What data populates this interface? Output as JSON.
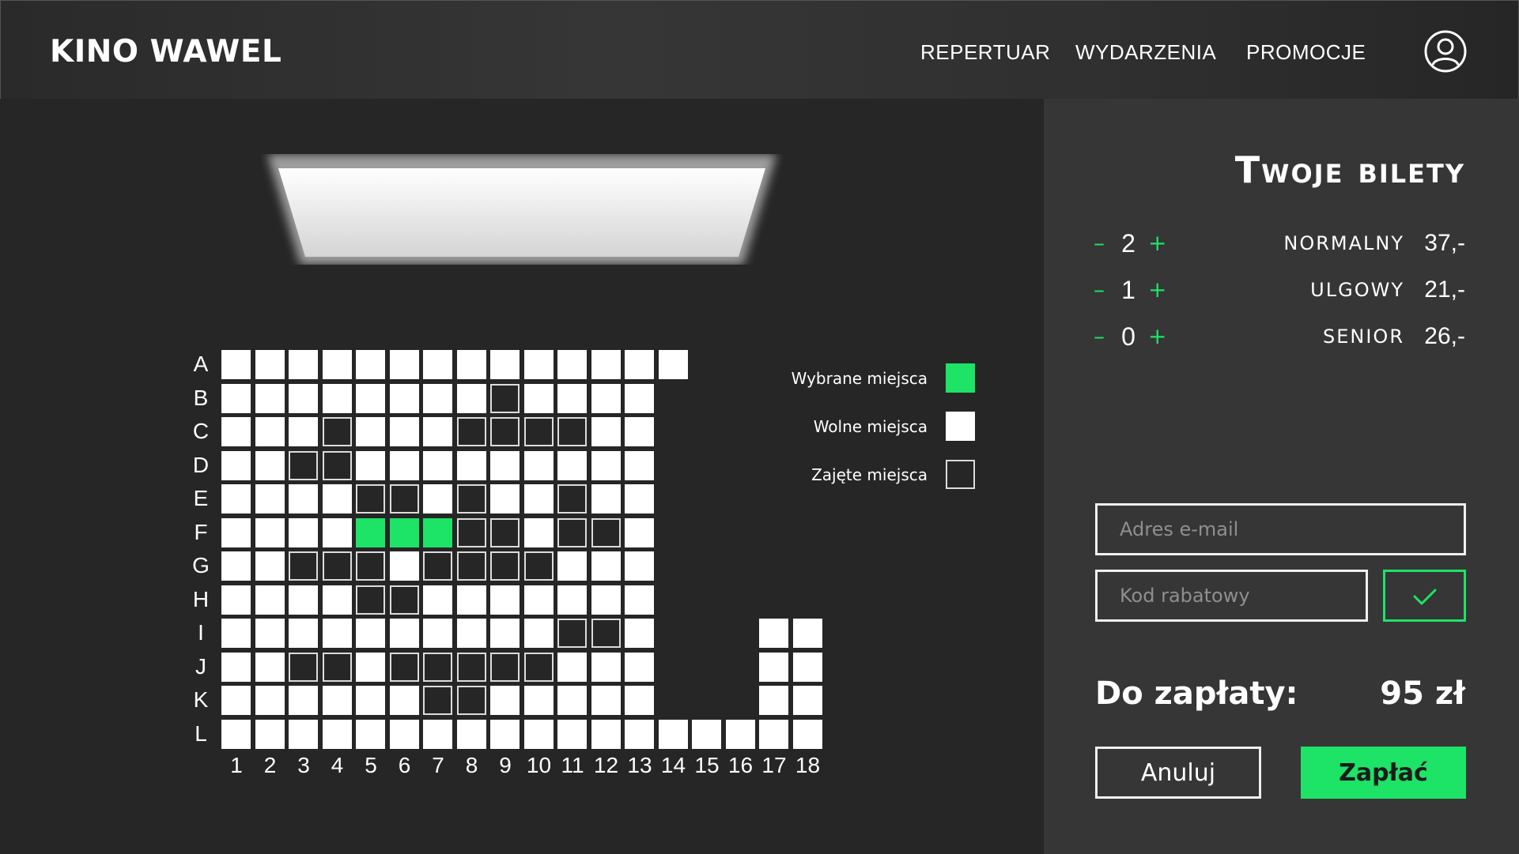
{
  "header": {
    "logo": "KINO WAWEL",
    "nav": [
      "REPERTUAR",
      "WYDARZENIA",
      "PROMOCJE"
    ],
    "user_icon": "user-circle-icon"
  },
  "hall": {
    "rows": [
      "A",
      "B",
      "C",
      "D",
      "E",
      "F",
      "G",
      "H",
      "I",
      "J",
      "K",
      "L"
    ],
    "columns": [
      "1",
      "2",
      "3",
      "4",
      "5",
      "6",
      "7",
      "8",
      "9",
      "10",
      "11",
      "12",
      "13",
      "14",
      "15",
      "16",
      "17",
      "18"
    ],
    "seat_map": [
      "ffffffffffffff-----",
      "ffffffffxffff-----",
      "fffxfffxxxxff-----",
      "ffxxfffffffff-----",
      "ffffxxfxffxff-----",
      "ffffsssxxfxxf-----",
      "ffxxxfxxxxfff-----",
      "ffffxxfffffff-----",
      "ffffffffffxxf---ff",
      "ffxxfxxxxxfff---ff",
      "ffffffxxfffff---ff",
      "ffffffffffffffffff"
    ],
    "legend": [
      {
        "label": "Wybrane miejsca",
        "state": "selected"
      },
      {
        "label": "Wolne miejsca",
        "state": "free"
      },
      {
        "label": "Zajęte miejsca",
        "state": "taken"
      }
    ]
  },
  "panel": {
    "title": "Twoje bilety",
    "tickets": [
      {
        "qty": "2",
        "name": "NORMALNY",
        "price": "37,-"
      },
      {
        "qty": "1",
        "name": "ULGOWY",
        "price": "21,-"
      },
      {
        "qty": "0",
        "name": "SENIOR",
        "price": "26,-"
      }
    ],
    "minus_symbol": "–",
    "plus_symbol": "+",
    "email_placeholder": "Adres e-mail",
    "discount_placeholder": "Kod rabatowy",
    "confirm_icon": "checkmark-icon",
    "total_label": "Do zapłaty:",
    "total_value": "95 zł",
    "cancel_label": "Anuluj",
    "pay_label": "Zapłać"
  },
  "colors": {
    "accent": "#1de366",
    "background": "#262626",
    "panel": "#363636"
  }
}
